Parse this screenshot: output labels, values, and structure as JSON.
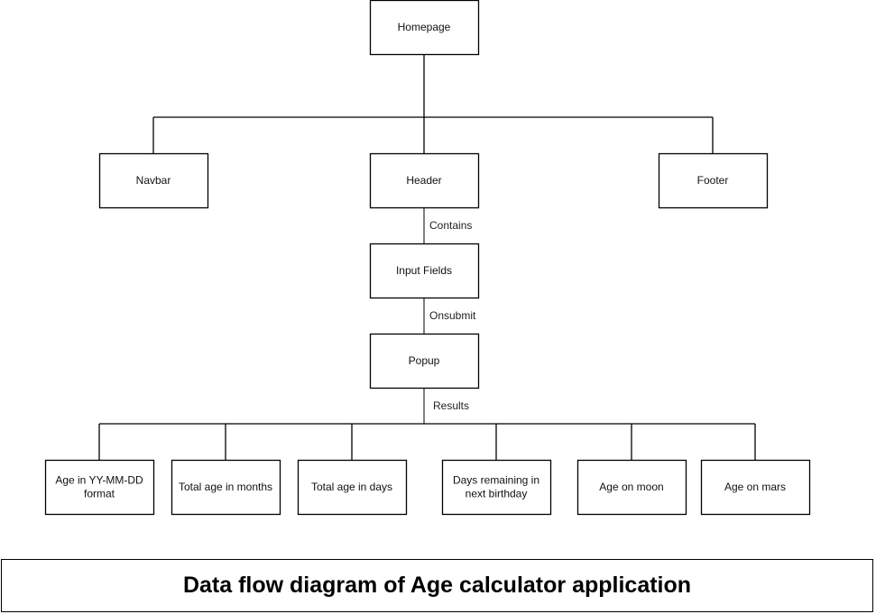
{
  "diagram": {
    "nodes": [
      {
        "id": "homepage",
        "label": [
          "Homepage"
        ]
      },
      {
        "id": "navbar",
        "label": [
          "Navbar"
        ]
      },
      {
        "id": "header",
        "label": [
          "Header"
        ]
      },
      {
        "id": "footer",
        "label": [
          "Footer"
        ]
      },
      {
        "id": "input-fields",
        "label": [
          "Input Fields"
        ]
      },
      {
        "id": "popup",
        "label": [
          "Popup"
        ]
      },
      {
        "id": "age-yymmdd",
        "label": [
          "Age in YY-MM-DD",
          "format"
        ]
      },
      {
        "id": "total-months",
        "label": [
          "Total age in months"
        ]
      },
      {
        "id": "total-days",
        "label": [
          "Total age in days"
        ]
      },
      {
        "id": "days-remaining",
        "label": [
          "Days remaining in",
          "next birthday"
        ]
      },
      {
        "id": "age-moon",
        "label": [
          "Age on moon"
        ]
      },
      {
        "id": "age-mars",
        "label": [
          "Age on mars"
        ]
      }
    ],
    "edges": [
      {
        "from": "homepage",
        "to": "navbar",
        "label": ""
      },
      {
        "from": "homepage",
        "to": "header",
        "label": ""
      },
      {
        "from": "homepage",
        "to": "footer",
        "label": ""
      },
      {
        "from": "header",
        "to": "input-fields",
        "label": "Contains"
      },
      {
        "from": "input-fields",
        "to": "popup",
        "label": "Onsubmit"
      },
      {
        "from": "popup",
        "to": "age-yymmdd",
        "label": "Results"
      },
      {
        "from": "popup",
        "to": "total-months",
        "label": ""
      },
      {
        "from": "popup",
        "to": "total-days",
        "label": ""
      },
      {
        "from": "popup",
        "to": "days-remaining",
        "label": ""
      },
      {
        "from": "popup",
        "to": "age-moon",
        "label": ""
      },
      {
        "from": "popup",
        "to": "age-mars",
        "label": ""
      }
    ]
  },
  "caption": "Data flow diagram of Age calculator application"
}
